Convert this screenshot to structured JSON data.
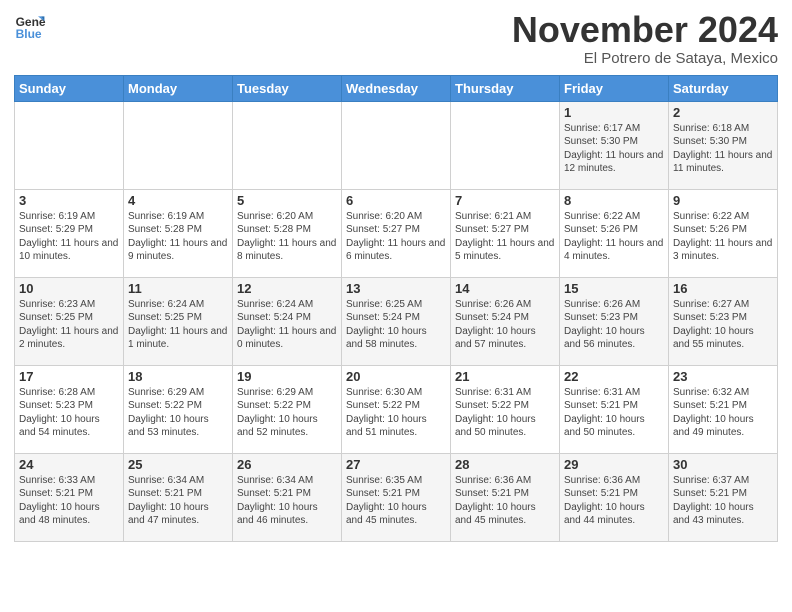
{
  "header": {
    "logo_line1": "General",
    "logo_line2": "Blue",
    "month_title": "November 2024",
    "location": "El Potrero de Sataya, Mexico"
  },
  "weekdays": [
    "Sunday",
    "Monday",
    "Tuesday",
    "Wednesday",
    "Thursday",
    "Friday",
    "Saturday"
  ],
  "weeks": [
    [
      {
        "day": "",
        "info": ""
      },
      {
        "day": "",
        "info": ""
      },
      {
        "day": "",
        "info": ""
      },
      {
        "day": "",
        "info": ""
      },
      {
        "day": "",
        "info": ""
      },
      {
        "day": "1",
        "info": "Sunrise: 6:17 AM\nSunset: 5:30 PM\nDaylight: 11 hours and 12 minutes."
      },
      {
        "day": "2",
        "info": "Sunrise: 6:18 AM\nSunset: 5:30 PM\nDaylight: 11 hours and 11 minutes."
      }
    ],
    [
      {
        "day": "3",
        "info": "Sunrise: 6:19 AM\nSunset: 5:29 PM\nDaylight: 11 hours and 10 minutes."
      },
      {
        "day": "4",
        "info": "Sunrise: 6:19 AM\nSunset: 5:28 PM\nDaylight: 11 hours and 9 minutes."
      },
      {
        "day": "5",
        "info": "Sunrise: 6:20 AM\nSunset: 5:28 PM\nDaylight: 11 hours and 8 minutes."
      },
      {
        "day": "6",
        "info": "Sunrise: 6:20 AM\nSunset: 5:27 PM\nDaylight: 11 hours and 6 minutes."
      },
      {
        "day": "7",
        "info": "Sunrise: 6:21 AM\nSunset: 5:27 PM\nDaylight: 11 hours and 5 minutes."
      },
      {
        "day": "8",
        "info": "Sunrise: 6:22 AM\nSunset: 5:26 PM\nDaylight: 11 hours and 4 minutes."
      },
      {
        "day": "9",
        "info": "Sunrise: 6:22 AM\nSunset: 5:26 PM\nDaylight: 11 hours and 3 minutes."
      }
    ],
    [
      {
        "day": "10",
        "info": "Sunrise: 6:23 AM\nSunset: 5:25 PM\nDaylight: 11 hours and 2 minutes."
      },
      {
        "day": "11",
        "info": "Sunrise: 6:24 AM\nSunset: 5:25 PM\nDaylight: 11 hours and 1 minute."
      },
      {
        "day": "12",
        "info": "Sunrise: 6:24 AM\nSunset: 5:24 PM\nDaylight: 11 hours and 0 minutes."
      },
      {
        "day": "13",
        "info": "Sunrise: 6:25 AM\nSunset: 5:24 PM\nDaylight: 10 hours and 58 minutes."
      },
      {
        "day": "14",
        "info": "Sunrise: 6:26 AM\nSunset: 5:24 PM\nDaylight: 10 hours and 57 minutes."
      },
      {
        "day": "15",
        "info": "Sunrise: 6:26 AM\nSunset: 5:23 PM\nDaylight: 10 hours and 56 minutes."
      },
      {
        "day": "16",
        "info": "Sunrise: 6:27 AM\nSunset: 5:23 PM\nDaylight: 10 hours and 55 minutes."
      }
    ],
    [
      {
        "day": "17",
        "info": "Sunrise: 6:28 AM\nSunset: 5:23 PM\nDaylight: 10 hours and 54 minutes."
      },
      {
        "day": "18",
        "info": "Sunrise: 6:29 AM\nSunset: 5:22 PM\nDaylight: 10 hours and 53 minutes."
      },
      {
        "day": "19",
        "info": "Sunrise: 6:29 AM\nSunset: 5:22 PM\nDaylight: 10 hours and 52 minutes."
      },
      {
        "day": "20",
        "info": "Sunrise: 6:30 AM\nSunset: 5:22 PM\nDaylight: 10 hours and 51 minutes."
      },
      {
        "day": "21",
        "info": "Sunrise: 6:31 AM\nSunset: 5:22 PM\nDaylight: 10 hours and 50 minutes."
      },
      {
        "day": "22",
        "info": "Sunrise: 6:31 AM\nSunset: 5:21 PM\nDaylight: 10 hours and 50 minutes."
      },
      {
        "day": "23",
        "info": "Sunrise: 6:32 AM\nSunset: 5:21 PM\nDaylight: 10 hours and 49 minutes."
      }
    ],
    [
      {
        "day": "24",
        "info": "Sunrise: 6:33 AM\nSunset: 5:21 PM\nDaylight: 10 hours and 48 minutes."
      },
      {
        "day": "25",
        "info": "Sunrise: 6:34 AM\nSunset: 5:21 PM\nDaylight: 10 hours and 47 minutes."
      },
      {
        "day": "26",
        "info": "Sunrise: 6:34 AM\nSunset: 5:21 PM\nDaylight: 10 hours and 46 minutes."
      },
      {
        "day": "27",
        "info": "Sunrise: 6:35 AM\nSunset: 5:21 PM\nDaylight: 10 hours and 45 minutes."
      },
      {
        "day": "28",
        "info": "Sunrise: 6:36 AM\nSunset: 5:21 PM\nDaylight: 10 hours and 45 minutes."
      },
      {
        "day": "29",
        "info": "Sunrise: 6:36 AM\nSunset: 5:21 PM\nDaylight: 10 hours and 44 minutes."
      },
      {
        "day": "30",
        "info": "Sunrise: 6:37 AM\nSunset: 5:21 PM\nDaylight: 10 hours and 43 minutes."
      }
    ]
  ]
}
